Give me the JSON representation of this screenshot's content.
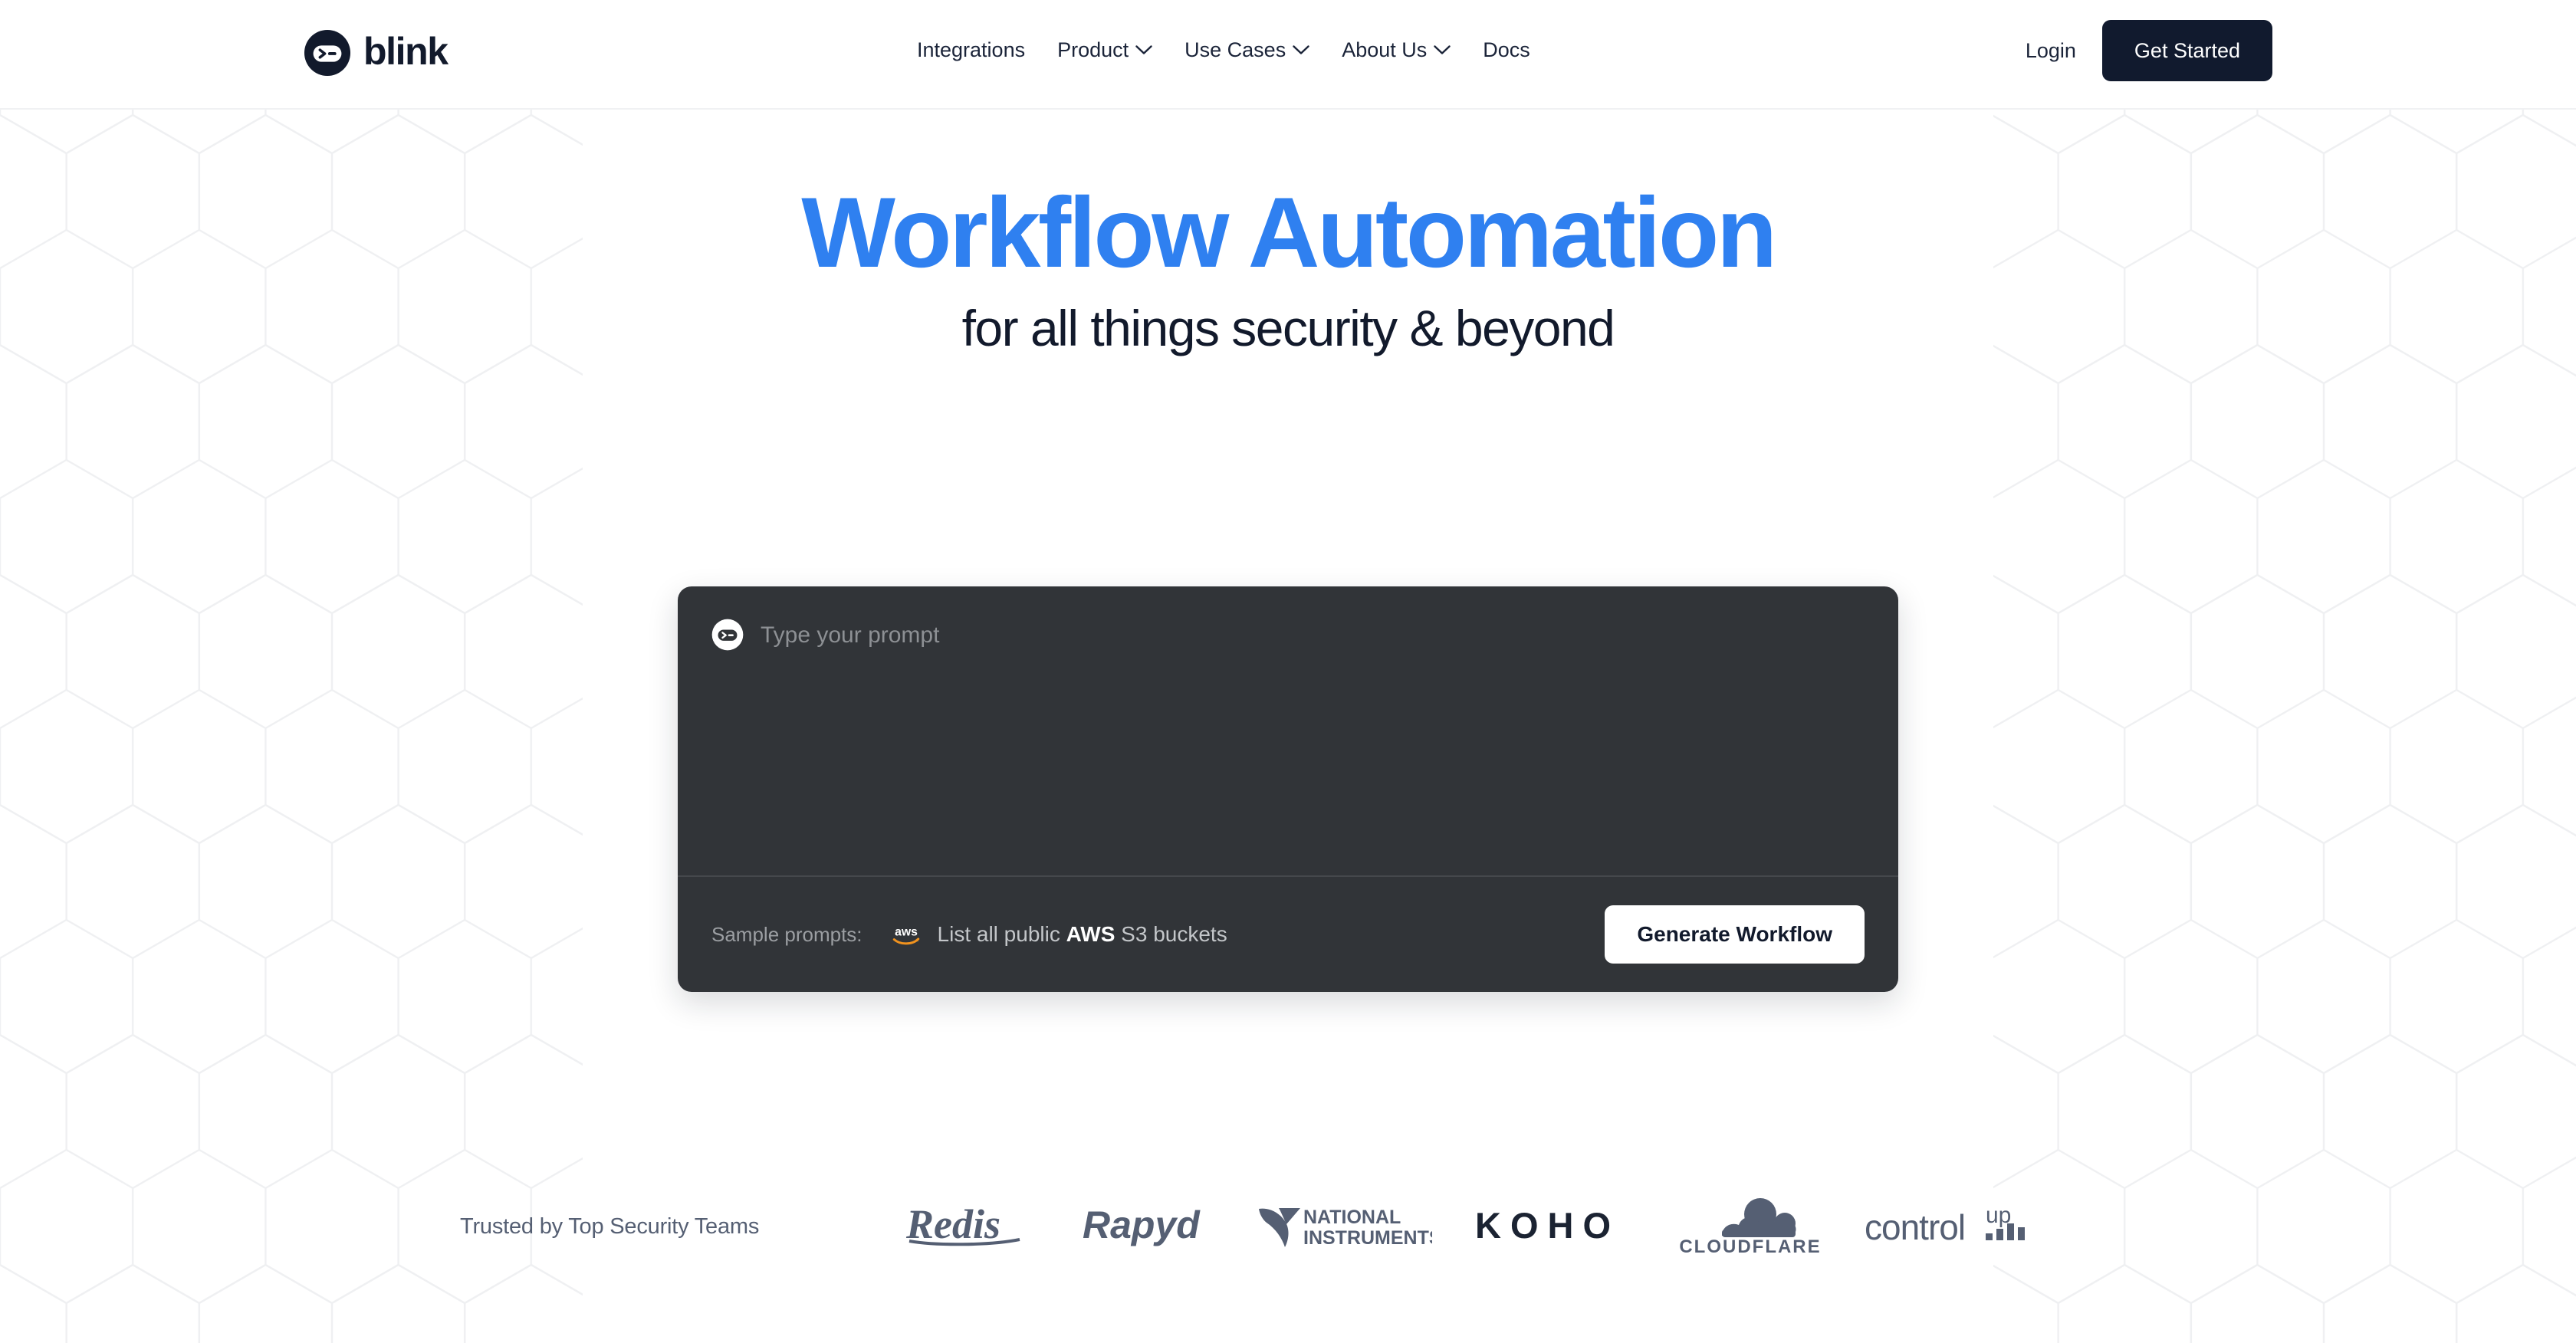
{
  "brand": {
    "name": "blink",
    "logo_icon": "blink-terminal-icon",
    "navy": "#121A2C",
    "accent_blue": "#2F80F0",
    "dark_card": "#313438",
    "slate": "#555F73"
  },
  "header": {
    "nav": [
      {
        "label": "Integrations",
        "has_chevron": false
      },
      {
        "label": "Product",
        "has_chevron": true
      },
      {
        "label": "Use Cases",
        "has_chevron": true
      },
      {
        "label": "About Us",
        "has_chevron": true
      },
      {
        "label": "Docs",
        "has_chevron": false
      }
    ],
    "login_label": "Login",
    "cta_label": "Get Started"
  },
  "hero": {
    "title": "Workflow Automation",
    "subtitle": "for all things security & beyond"
  },
  "prompt": {
    "icon": "blink-terminal-icon",
    "placeholder": "Type your prompt",
    "value": "",
    "sample_label": "Sample prompts:",
    "sample": {
      "icon": "aws-logo-icon",
      "text_before": "List all public ",
      "text_bold": "AWS",
      "text_after": " S3 buckets",
      "full_text": "List all public AWS S3 buckets"
    },
    "generate_label": "Generate Workflow"
  },
  "trusted": {
    "label": "Trusted by Top Security Teams",
    "logos": [
      {
        "name": "redis-logo",
        "label": "Redis"
      },
      {
        "name": "rapyd-logo",
        "label": "Rapyd"
      },
      {
        "name": "national-instruments-logo",
        "label": "NATIONAL INSTRUMENTS"
      },
      {
        "name": "koho-logo",
        "label": "K O H O"
      },
      {
        "name": "cloudflare-logo",
        "label": "CLOUDFLARE"
      },
      {
        "name": "controlup-logo",
        "label": "control up"
      }
    ]
  }
}
